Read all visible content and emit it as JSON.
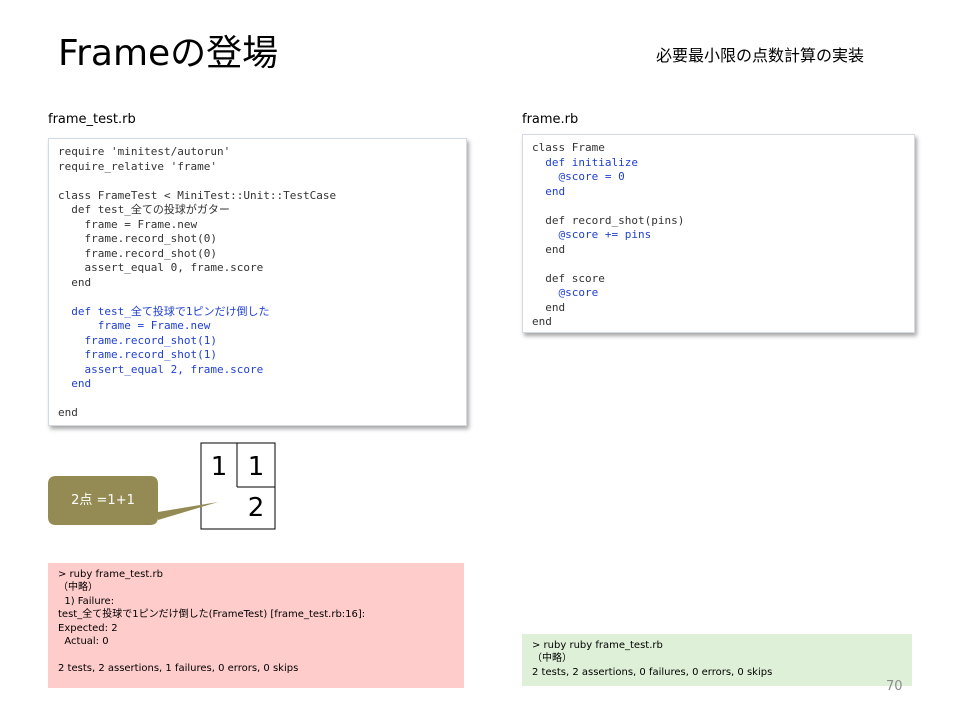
{
  "slide": {
    "title": "Frameの登場",
    "subtitle": "必要最小限の点数計算の実装",
    "page_number": "70"
  },
  "left_file": {
    "name": "frame_test.rb",
    "lines": [
      {
        "text": "require 'minitest/autorun'",
        "highlight": false
      },
      {
        "text": "require_relative 'frame'",
        "highlight": false
      },
      {
        "text": "",
        "highlight": false
      },
      {
        "text": "class FrameTest < MiniTest::Unit::TestCase",
        "highlight": false
      },
      {
        "text": "  def test_全ての投球がガター",
        "highlight": false
      },
      {
        "text": "    frame = Frame.new",
        "highlight": false
      },
      {
        "text": "    frame.record_shot(0)",
        "highlight": false
      },
      {
        "text": "    frame.record_shot(0)",
        "highlight": false
      },
      {
        "text": "    assert_equal 0, frame.score",
        "highlight": false
      },
      {
        "text": "  end",
        "highlight": false
      },
      {
        "text": "",
        "highlight": false
      },
      {
        "text": "  def test_全て投球で1ピンだけ倒した",
        "highlight": true
      },
      {
        "text": "      frame = Frame.new",
        "highlight": true
      },
      {
        "text": "    frame.record_shot(1)",
        "highlight": true
      },
      {
        "text": "    frame.record_shot(1)",
        "highlight": true
      },
      {
        "text": "    assert_equal 2, frame.score",
        "highlight": true
      },
      {
        "text": "  end",
        "highlight": true
      },
      {
        "text": "",
        "highlight": false
      },
      {
        "text": "end",
        "highlight": false
      }
    ]
  },
  "right_file": {
    "name": "frame.rb",
    "lines": [
      {
        "text": "class Frame",
        "highlight": false
      },
      {
        "text": "  def initialize",
        "highlight": true
      },
      {
        "text": "    @score = 0",
        "highlight": true
      },
      {
        "text": "  end",
        "highlight": true
      },
      {
        "text": "",
        "highlight": false
      },
      {
        "text": "  def record_shot(pins)",
        "highlight": false
      },
      {
        "text": "    @score += pins",
        "highlight": true
      },
      {
        "text": "  end",
        "highlight": false
      },
      {
        "text": "",
        "highlight": false
      },
      {
        "text": "  def score",
        "highlight": false
      },
      {
        "text": "    @score",
        "highlight": true
      },
      {
        "text": "  end",
        "highlight": false
      },
      {
        "text": "end",
        "highlight": false
      }
    ]
  },
  "frame_diagram": {
    "first_shot": "1",
    "second_shot": "1",
    "frame_score": "2"
  },
  "callout": {
    "text": "2点 =1+1",
    "color": "#948a54"
  },
  "fail_result": {
    "color": "#ffcccc",
    "lines": [
      "> ruby frame_test.rb",
      "（中略）",
      "  1) Failure:",
      "test_全て投球で1ピンだけ倒した(FrameTest) [frame_test.rb:16]:",
      "Expected: 2",
      "  Actual: 0",
      "",
      "2 tests, 2 assertions, 1 failures, 0 errors, 0 skips"
    ]
  },
  "pass_result": {
    "color": "#dff0d8",
    "lines": [
      "> ruby ruby frame_test.rb",
      "（中略）",
      "2 tests, 2 assertions, 0 failures, 0 errors, 0 skips"
    ]
  },
  "colors": {
    "highlight_code": "#1f3fd0",
    "normal_code": "#333333"
  }
}
